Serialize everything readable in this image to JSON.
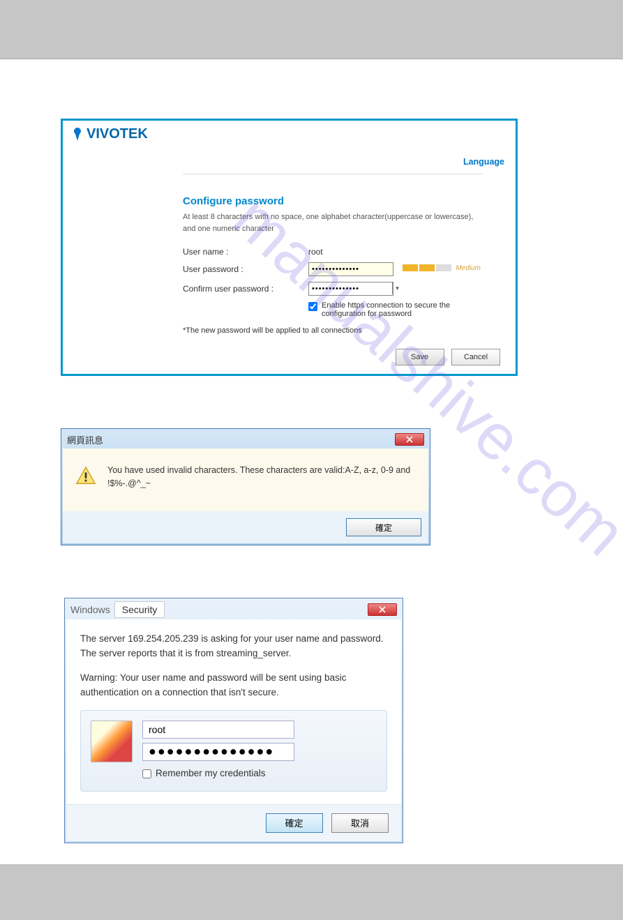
{
  "vivotek": {
    "logo_text": "VIVOTEK",
    "lang_label": "Language",
    "section_title": "Configure password",
    "requirements": "At least 8 characters with no space, one alphabet character(uppercase or lowercase), and one numeric character",
    "username_label": "User name :",
    "username_value": "root",
    "password_label": "User password :",
    "password_value": "••••••••••••••",
    "strength_text": "Medium",
    "confirm_label": "Confirm user password :",
    "confirm_value": "••••••••••••••",
    "https_label": "Enable https connection to secure the configuration for password",
    "note": "*The new password will be applied to all connections",
    "save_btn": "Save",
    "cancel_btn": "Cancel"
  },
  "alert": {
    "title": "網頁訊息",
    "message": "You have used invalid characters. These characters are valid:A-Z, a-z, 0-9 and !$%-.@^_~",
    "ok": "確定"
  },
  "security": {
    "title_prefix": "Windows",
    "title": "Security",
    "server_msg": "The server 169.254.205.239 is asking for your user name and password. The server reports that it is from streaming_server.",
    "warning_msg": "Warning: Your user name and password will be sent using basic authentication on a connection that isn't secure.",
    "username_value": "root",
    "password_value": "●●●●●●●●●●●●●●",
    "remember_label": "Remember my credentials",
    "ok_btn": "確定",
    "cancel_btn": "取消"
  },
  "watermark": "manualshive.com"
}
